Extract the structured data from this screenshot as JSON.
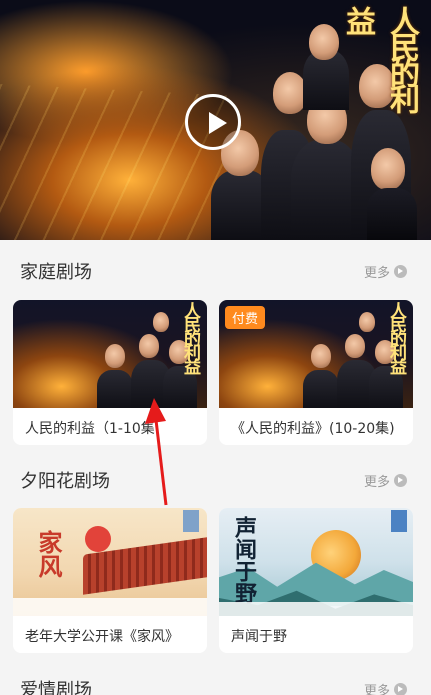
{
  "hero": {
    "title_art": "人民的利益",
    "play_icon": "play-icon"
  },
  "sections": [
    {
      "title": "家庭剧场",
      "more_label": "更多",
      "cards": [
        {
          "label": "人民的利益（1-10集",
          "thumb_art": "人民的利益",
          "badge": ""
        },
        {
          "label": "《人民的利益》(10-20集)",
          "thumb_art": "人民的利益",
          "badge": "付费"
        }
      ]
    },
    {
      "title": "夕阳花剧场",
      "more_label": "更多",
      "cards": [
        {
          "label": "老年大学公开课《家风》",
          "thumb_art": "家风",
          "badge": ""
        },
        {
          "label": "声闻于野",
          "thumb_art": "声闻于野",
          "badge": ""
        }
      ]
    },
    {
      "title": "爱情剧场",
      "more_label": "更多"
    }
  ],
  "colors": {
    "background": "#f4f4f4",
    "badge": "#ff8a1e",
    "arrow": "#e51b1b"
  }
}
